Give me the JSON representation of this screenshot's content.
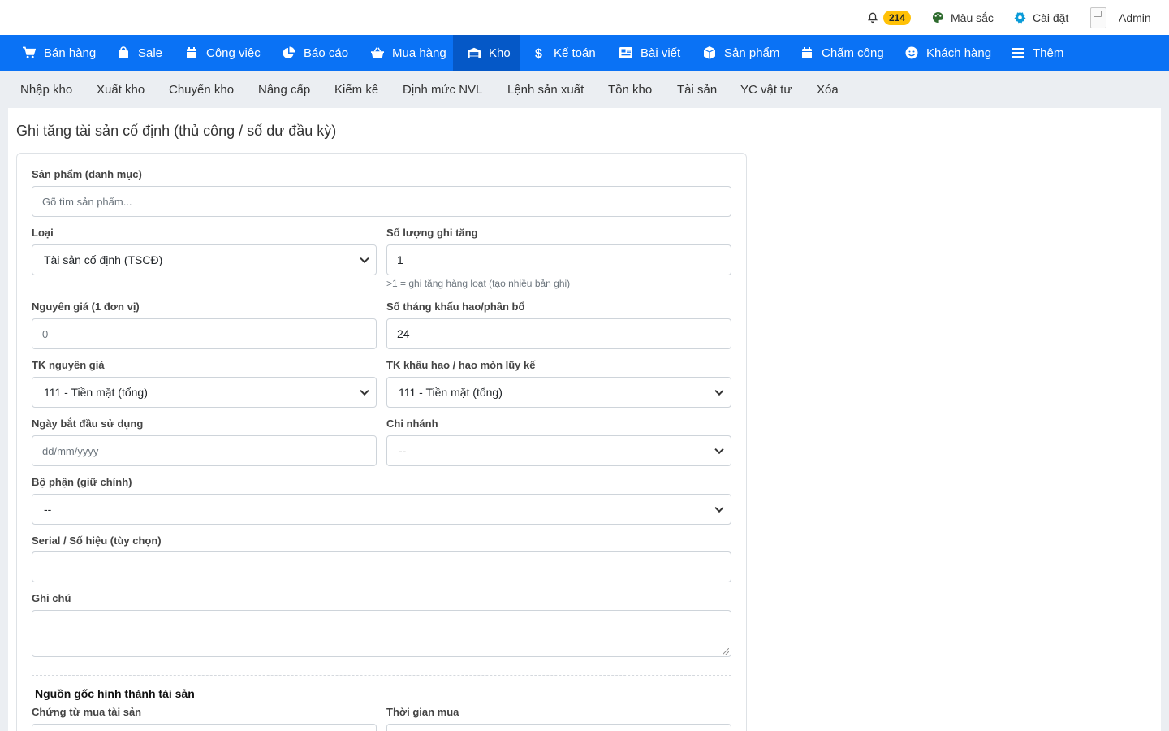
{
  "topbar": {
    "notifications_count": "214",
    "mausac": "Màu sắc",
    "caidat": "Cài đặt",
    "admin": "Admin"
  },
  "nav": [
    {
      "label": "Bán hàng",
      "icon": "cart-icon"
    },
    {
      "label": "Sale",
      "icon": "bag-icon"
    },
    {
      "label": "Công việc",
      "icon": "calendar-icon"
    },
    {
      "label": "Báo cáo",
      "icon": "pie-chart-icon"
    },
    {
      "label": "Mua hàng",
      "icon": "basket-icon"
    },
    {
      "label": "Kho",
      "icon": "warehouse-icon",
      "active": true
    },
    {
      "label": "Kế toán",
      "icon": "dollar-icon"
    },
    {
      "label": "Bài viết",
      "icon": "newspaper-icon"
    },
    {
      "label": "Sản phẩm",
      "icon": "box-icon"
    },
    {
      "label": "Chấm công",
      "icon": "calendar-icon"
    },
    {
      "label": "Khách hàng",
      "icon": "smile-icon"
    },
    {
      "label": "Thêm",
      "icon": "menu-icon"
    }
  ],
  "subnav": [
    "Nhập kho",
    "Xuất kho",
    "Chuyển kho",
    "Nâng cấp",
    "Kiểm kê",
    "Định mức NVL",
    "Lệnh sản xuất",
    "Tồn kho",
    "Tài sản",
    "YC vật tư",
    "Xóa"
  ],
  "page": {
    "title": "Ghi tăng tài sản cố định (thủ công / số dư đầu kỳ)"
  },
  "form": {
    "product_label": "Sản phẩm (danh mục)",
    "product_placeholder": "Gõ tìm sản phẩm...",
    "type_label": "Loại",
    "type_value": "Tài sản cố định (TSCĐ)",
    "qty_label": "Số lượng ghi tăng",
    "qty_value": "1",
    "qty_hint": ">1 = ghi tăng hàng loạt (tạo nhiều bản ghi)",
    "price_label": "Nguyên giá (1 đơn vị)",
    "price_placeholder": "0",
    "months_label": "Số tháng khấu hao/phân bổ",
    "months_value": "24",
    "tk_nguyen_gia_label": "TK nguyên giá",
    "tk_nguyen_gia_value": "111 - Tiền mặt (tổng)",
    "tk_khau_hao_label": "TK khấu hao / hao mòn lũy kế",
    "tk_khau_hao_value": "111 - Tiền mặt (tổng)",
    "start_date_label": "Ngày bắt đầu sử dụng",
    "start_date_placeholder": "dd/mm/yyyy",
    "branch_label": "Chi nhánh",
    "branch_value": "--",
    "dept_label": "Bộ phận (giữ chính)",
    "dept_value": "--",
    "serial_label": "Serial / Số hiệu (tùy chọn)",
    "note_label": "Ghi chú",
    "origin_section_title": "Nguồn gốc hình thành tài sản",
    "purchase_doc_label": "Chứng từ mua tài sản",
    "purchase_time_label": "Thời gian mua"
  }
}
